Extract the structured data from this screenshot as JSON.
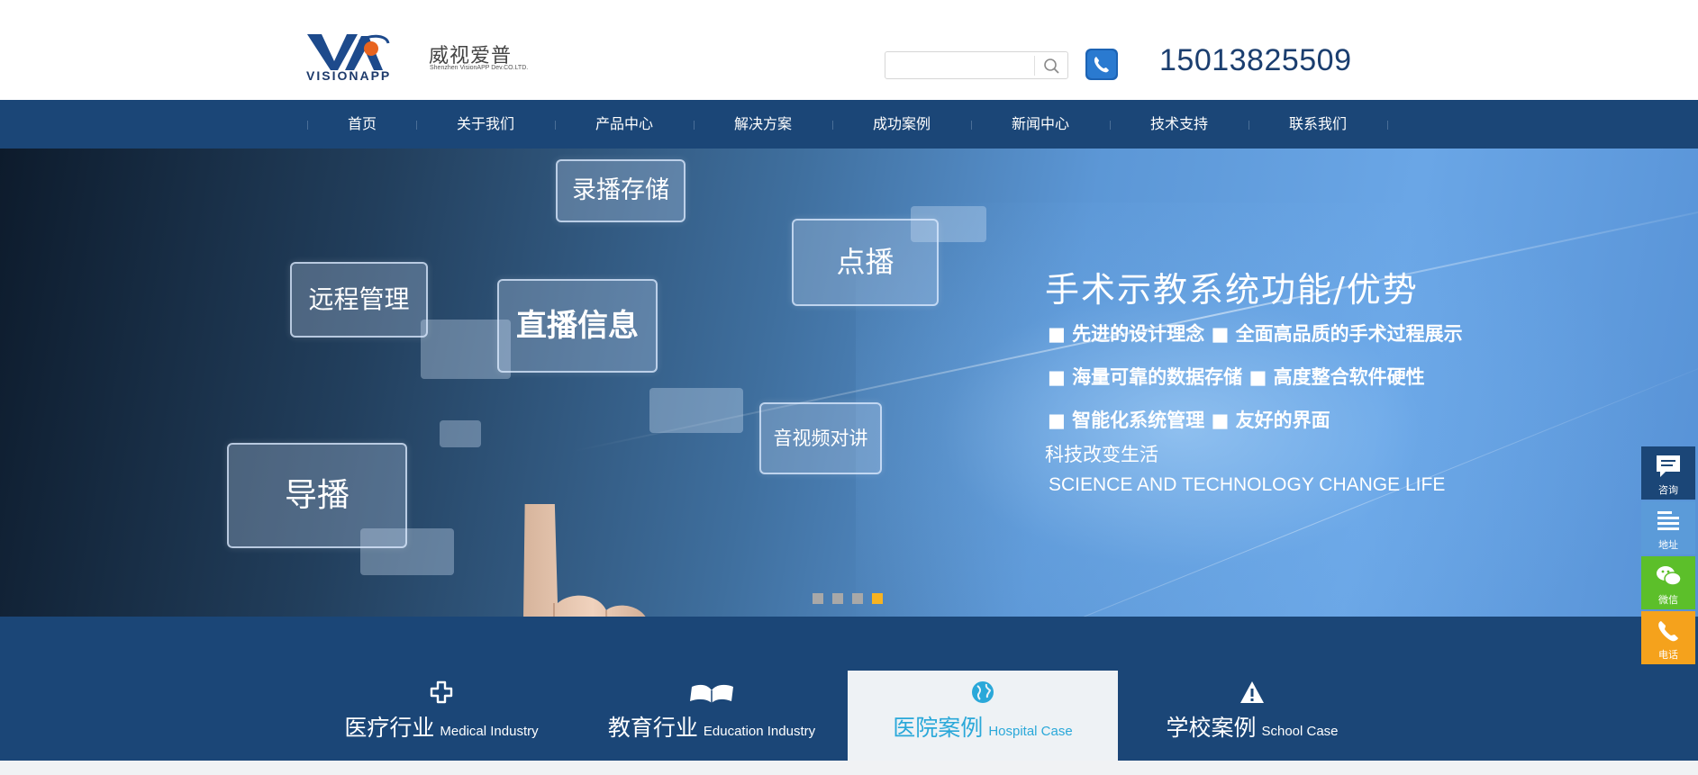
{
  "header": {
    "logo_en": "VISIONAPP",
    "logo_cn": "威视爱普",
    "logo_sub": "Shenzhen VisionAPP Dev.CO.LTD.",
    "search_placeholder": "",
    "phone_number": "15013825509"
  },
  "nav": {
    "items": [
      {
        "label": "首页"
      },
      {
        "label": "关于我们"
      },
      {
        "label": "产品中心"
      },
      {
        "label": "解决方案"
      },
      {
        "label": "成功案例"
      },
      {
        "label": "新闻中心"
      },
      {
        "label": "技术支持"
      },
      {
        "label": "联系我们"
      }
    ]
  },
  "banner": {
    "tiles": {
      "record": "录播存储",
      "remote": "远程管理",
      "live": "直播信息",
      "vod": "点播",
      "av_intercom": "音视频对讲",
      "director": "导播"
    },
    "headline": "手术示教系统功能/优势",
    "features": [
      "■ 先进的设计理念  ■ 全面高品质的手术过程展示",
      "■ 海量可靠的数据存储  ■ 高度整合软件硬性",
      "■ 智能化系统管理  ■ 友好的界面"
    ],
    "slogan_cn": "科技改变生活",
    "slogan_en": "SCIENCE AND TECHNOLOGY CHANGE LIFE",
    "slide_count": 4,
    "active_slide": 4
  },
  "industries": [
    {
      "cn": "医疗行业",
      "en": "Medical Industry",
      "icon": "medical-cross-icon",
      "active": false
    },
    {
      "cn": "教育行业",
      "en": "Education Industry",
      "icon": "open-book-icon",
      "active": false
    },
    {
      "cn": "医院案例",
      "en": "Hospital Case",
      "icon": "globe-icon",
      "active": true
    },
    {
      "cn": "学校案例",
      "en": "School Case",
      "icon": "warning-triangle-icon",
      "active": false
    }
  ],
  "side_float": [
    {
      "label": "咨询",
      "icon": "chat-icon",
      "color": "#1b4677"
    },
    {
      "label": "地址",
      "icon": "list-icon",
      "color": "#5b9bd9"
    },
    {
      "label": "微信",
      "icon": "wechat-icon",
      "color": "#5cbf2a"
    },
    {
      "label": "电话",
      "icon": "phone-icon",
      "color": "#f5a21c"
    }
  ],
  "colors": {
    "nav_bg": "#1b4677",
    "phone_text": "#1b3e6f",
    "active_case": "#2aa8d9",
    "slide_dot_active": "#f7b321"
  }
}
